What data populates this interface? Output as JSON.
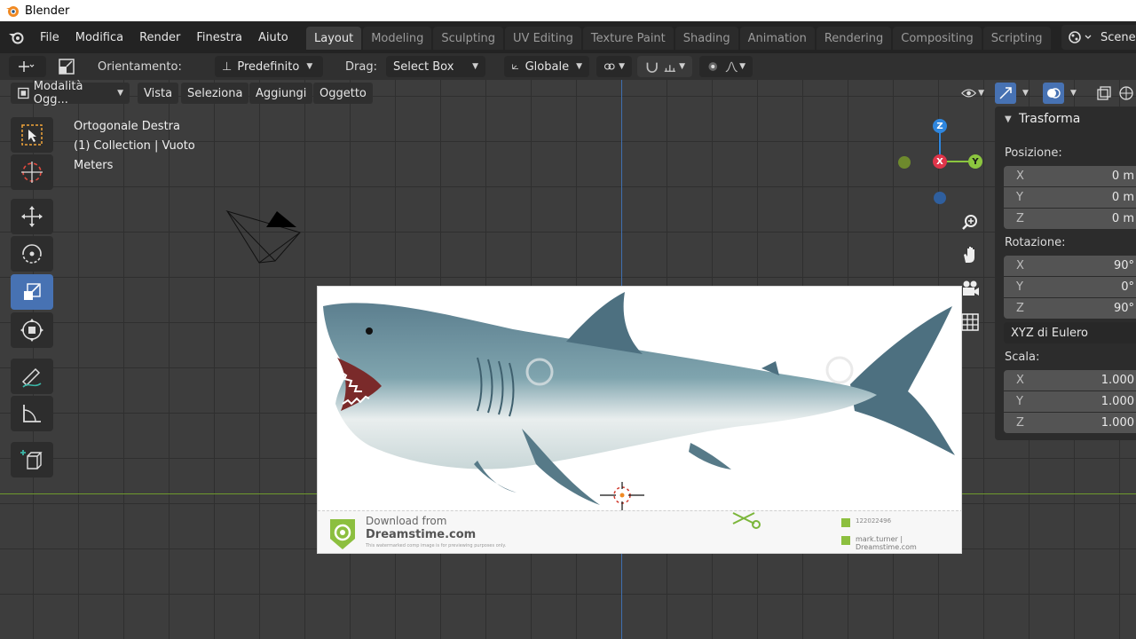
{
  "app": {
    "title": "Blender"
  },
  "menubar": {
    "items": [
      "File",
      "Modifica",
      "Render",
      "Finestra",
      "Aiuto"
    ],
    "workspaces": [
      "Layout",
      "Modeling",
      "Sculpting",
      "UV Editing",
      "Texture Paint",
      "Shading",
      "Animation",
      "Rendering",
      "Compositing",
      "Scripting"
    ],
    "active_workspace": "Layout",
    "scene_label": "Scene"
  },
  "toolsettings": {
    "orientation_label": "Orientamento:",
    "orientation_value": "Predefinito",
    "drag_label": "Drag:",
    "drag_value": "Select Box",
    "transform_orientation": "Globale"
  },
  "viewheader": {
    "mode": "Modalità Ogg...",
    "menus": [
      "Vista",
      "Seleziona",
      "Aggiungi",
      "Oggetto"
    ]
  },
  "viewport": {
    "view_name": "Ortogonale Destra",
    "collection_info": "(1) Collection | Vuoto",
    "units": "Meters",
    "axis_labels": {
      "z": "Z",
      "x": "X",
      "y": "Y"
    },
    "tools": [
      "select-box",
      "cursor",
      "move",
      "rotate",
      "scale",
      "transform",
      "annotate",
      "measure",
      "add-cube"
    ],
    "active_tool": "scale"
  },
  "reference_image": {
    "download_line1": "Download from",
    "download_line2": "Dreamstime.com",
    "download_line3": "This watermarked comp image is for previewing purposes only.",
    "image_id": "122022496",
    "author": "mark.turner | Dreamstime.com"
  },
  "sidebar": {
    "title": "Trasforma",
    "location_label": "Posizione:",
    "location": [
      {
        "axis": "X",
        "value": "0 m"
      },
      {
        "axis": "Y",
        "value": "0 m"
      },
      {
        "axis": "Z",
        "value": "0 m"
      }
    ],
    "rotation_label": "Rotazione:",
    "rotation": [
      {
        "axis": "X",
        "value": "90°"
      },
      {
        "axis": "Y",
        "value": "0°"
      },
      {
        "axis": "Z",
        "value": "90°"
      }
    ],
    "rotation_mode": "XYZ di Eulero",
    "scale_label": "Scala:",
    "scale": [
      {
        "axis": "X",
        "value": "1.000"
      },
      {
        "axis": "Y",
        "value": "1.000"
      },
      {
        "axis": "Z",
        "value": "1.000"
      }
    ]
  },
  "colors": {
    "accent": "#4772b3",
    "axis_x": "#e0354a",
    "axis_y": "#8cc63f",
    "axis_z": "#2e86de"
  }
}
